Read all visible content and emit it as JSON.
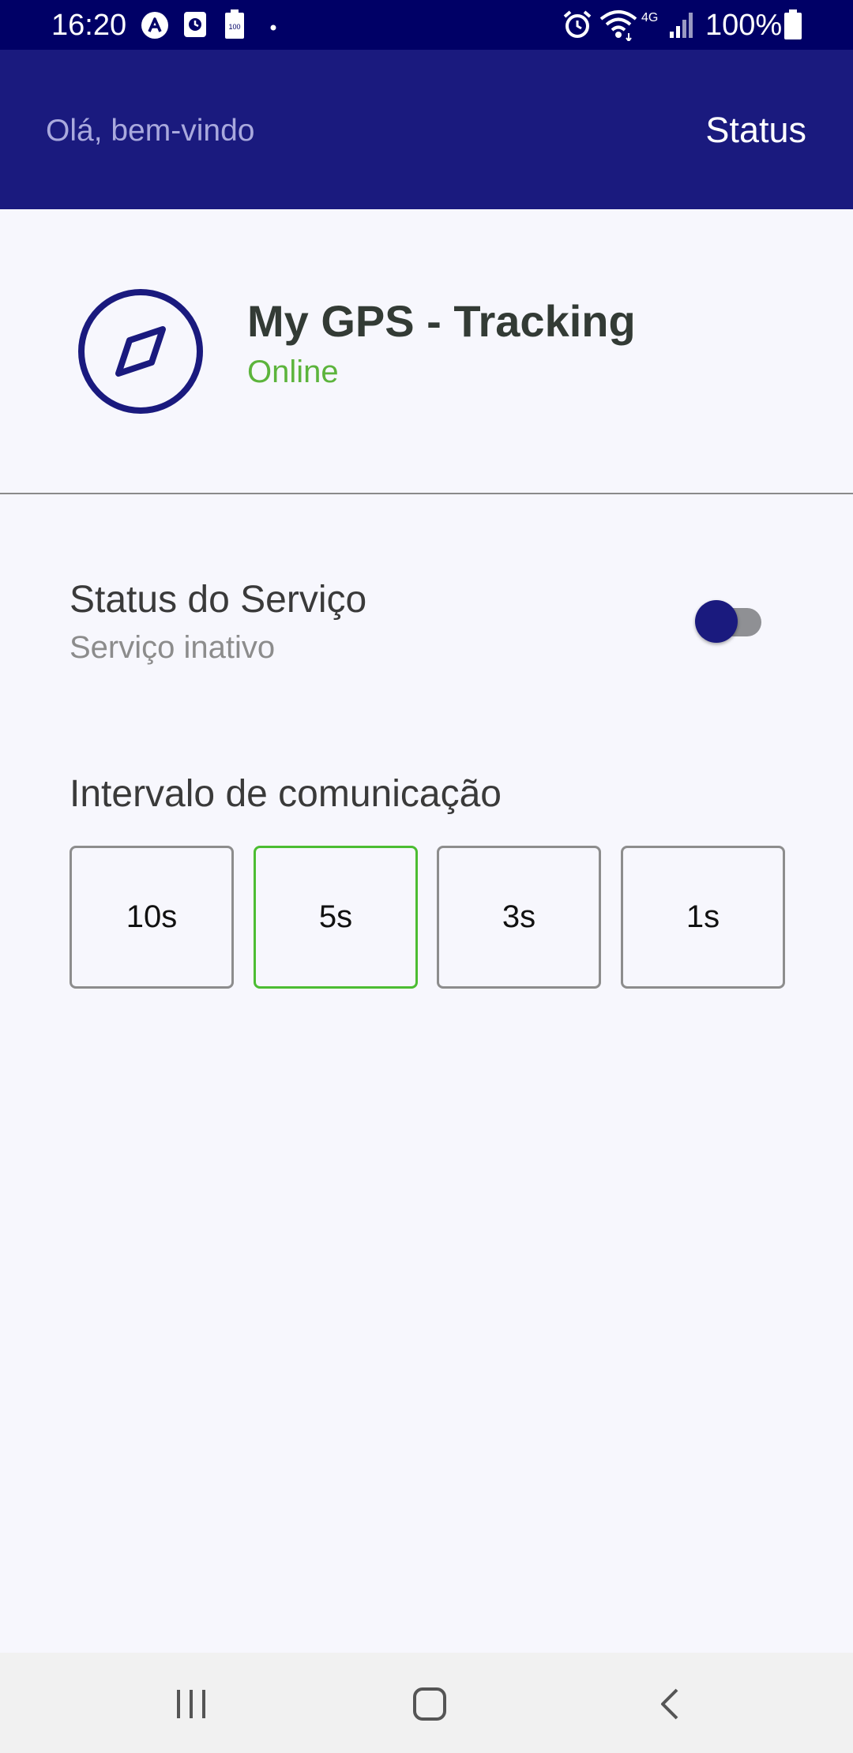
{
  "status_bar": {
    "time": "16:20",
    "battery": "100%",
    "network": "4G",
    "icons": [
      "a-icon",
      "clock-app-icon",
      "battery-100-icon",
      "dot-icon",
      "alarm-icon",
      "wifi-icon",
      "signal-icon",
      "battery-icon"
    ]
  },
  "app_bar": {
    "greeting": "Olá, bem-vindo",
    "status_tab": "Status"
  },
  "header": {
    "title": "My GPS - Tracking",
    "state": "Online",
    "icon": "compass-icon"
  },
  "service": {
    "title": "Status do Serviço",
    "subtitle": "Serviço inativo",
    "enabled": false
  },
  "interval": {
    "title": "Intervalo de comunicação",
    "options": [
      {
        "label": "10s",
        "selected": false
      },
      {
        "label": "5s",
        "selected": true
      },
      {
        "label": "3s",
        "selected": false
      },
      {
        "label": "1s",
        "selected": false
      }
    ]
  },
  "nav": {
    "icons": [
      "recent-apps-icon",
      "home-icon",
      "back-icon"
    ]
  },
  "colors": {
    "status_bar": "#000066",
    "primary": "#1a1a7e",
    "online": "#5cb43c",
    "selected_border": "#4cbd32",
    "background": "#f7f7fd"
  }
}
